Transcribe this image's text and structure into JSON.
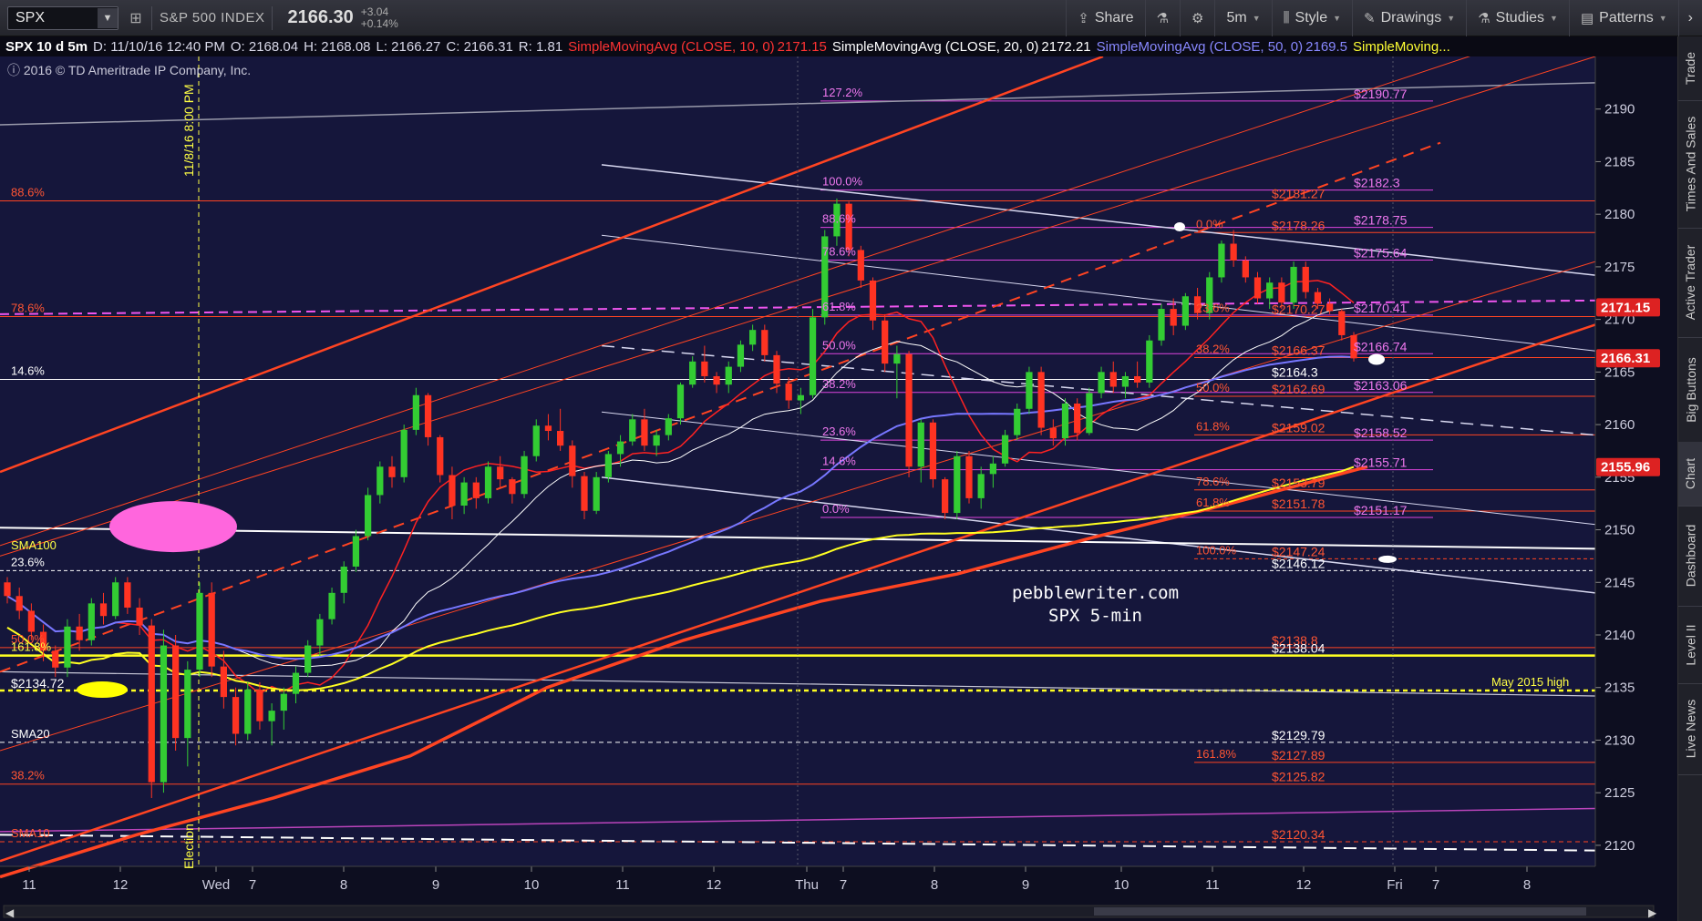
{
  "toolbar": {
    "symbol": "SPX",
    "name": "S&P 500 INDEX",
    "price": "2166.30",
    "change": "+3.04",
    "change_pct": "+0.14%",
    "buttons": [
      {
        "label": "Share",
        "icon": "share-icon"
      },
      {
        "label": "",
        "icon": "flask-icon"
      },
      {
        "label": "",
        "icon": "gear-icon"
      },
      {
        "label": "5m",
        "icon": ""
      },
      {
        "label": "Style",
        "icon": "style-icon"
      },
      {
        "label": "Drawings",
        "icon": "pencil-icon"
      },
      {
        "label": "Studies",
        "icon": "flask-icon"
      },
      {
        "label": "Patterns",
        "icon": "patterns-icon"
      }
    ]
  },
  "infobar": {
    "aggregation": "SPX 10 d 5m",
    "date": "D: 11/10/16 12:40 PM",
    "open": "O: 2168.04",
    "high": "H: 2168.08",
    "low": "L: 2166.27",
    "close": "C: 2166.31",
    "range": "R: 1.81",
    "studies": [
      {
        "label": "SimpleMovingAvg (CLOSE, 10, 0)",
        "value": "2171.15",
        "color": "#ff3333"
      },
      {
        "label": "SimpleMovingAvg (CLOSE, 20, 0)",
        "value": "2172.21",
        "color": "#ffffff"
      },
      {
        "label": "SimpleMovingAvg (CLOSE, 50, 0)",
        "value": "2169.5",
        "color": "#8888ff"
      },
      {
        "label": "SimpleMoving...",
        "value": "",
        "color": "#ffff33"
      }
    ]
  },
  "copyright": "2016 © TD Ameritrade IP Company, Inc.",
  "right_tabs": [
    "Trade",
    "Times And Sales",
    "Active Trader",
    "Big Buttons",
    "Chart",
    "Dashboard",
    "Level II",
    "Live News"
  ],
  "colors": {
    "background": "#15163b",
    "up_candle": "#33cc33",
    "down_candle": "#ff3322",
    "sma10": "#ff2222",
    "sma20": "#ffffff",
    "sma50": "#7777ff",
    "sma100": "#ffff22",
    "fib_pink": "#ee55ee",
    "fib_orange": "#ff4422",
    "channel_white": "#d8d8f0"
  },
  "chart_data": {
    "type": "candlestick",
    "symbol": "SPX",
    "interval": "5m",
    "ylim": [
      2118,
      2195
    ],
    "y_ticks": [
      2120,
      2125,
      2130,
      2135,
      2140,
      2145,
      2150,
      2155,
      2160,
      2165,
      2170,
      2175,
      2180,
      2185,
      2190
    ],
    "x_ticks": [
      "11",
      "12",
      "Wed",
      "7",
      "8",
      "9",
      "10",
      "11",
      "12",
      "Thu",
      "7",
      "8",
      "9",
      "10",
      "11",
      "12",
      "Fri",
      "7",
      "8"
    ],
    "price_badges": [
      {
        "value": "2171.15",
        "color": "#dd2222"
      },
      {
        "value": "2166.31",
        "color": "#dd2222"
      },
      {
        "value": "2155.96",
        "color": "#dd2222"
      }
    ],
    "candles": [
      [
        2145.0,
        2145.5,
        2143.0,
        2143.7
      ],
      [
        2143.7,
        2144.5,
        2141.5,
        2142.3
      ],
      [
        2142.3,
        2143.0,
        2139.5,
        2140.3
      ],
      [
        2140.3,
        2141.0,
        2137.5,
        2138.5
      ],
      [
        2138.5,
        2139.0,
        2136.0,
        2136.9
      ],
      [
        2136.9,
        2141.5,
        2136.0,
        2140.8
      ],
      [
        2140.8,
        2142.0,
        2138.5,
        2139.5
      ],
      [
        2139.5,
        2143.5,
        2139.0,
        2143.0
      ],
      [
        2143.0,
        2144.0,
        2141.0,
        2141.8
      ],
      [
        2141.8,
        2145.5,
        2141.5,
        2145.0
      ],
      [
        2145.0,
        2145.5,
        2142.0,
        2142.6
      ],
      [
        2142.6,
        2143.5,
        2140.0,
        2140.9
      ],
      [
        2140.9,
        2141.5,
        2124.5,
        2126.0
      ],
      [
        2126.0,
        2140.5,
        2125.0,
        2139.0
      ],
      [
        2139.0,
        2140.0,
        2129.0,
        2130.2
      ],
      [
        2130.2,
        2137.5,
        2127.5,
        2136.7
      ],
      [
        2136.7,
        2145.0,
        2136.0,
        2144.0
      ],
      [
        2144.0,
        2145.0,
        2136.0,
        2137.0
      ],
      [
        2137.0,
        2138.5,
        2133.0,
        2134.1
      ],
      [
        2134.1,
        2135.0,
        2129.5,
        2130.6
      ],
      [
        2130.6,
        2135.5,
        2130.0,
        2134.8
      ],
      [
        2134.8,
        2135.5,
        2131.0,
        2131.8
      ],
      [
        2131.8,
        2133.5,
        2129.5,
        2132.8
      ],
      [
        2132.8,
        2135.0,
        2131.0,
        2134.4
      ],
      [
        2134.4,
        2137.0,
        2133.5,
        2136.4
      ],
      [
        2136.4,
        2139.5,
        2136.0,
        2139.0
      ],
      [
        2139.0,
        2142.0,
        2138.0,
        2141.5
      ],
      [
        2141.5,
        2144.5,
        2141.0,
        2144.0
      ],
      [
        2144.0,
        2147.0,
        2143.0,
        2146.5
      ],
      [
        2146.5,
        2150.0,
        2146.0,
        2149.4
      ],
      [
        2149.4,
        2154.0,
        2149.0,
        2153.3
      ],
      [
        2153.3,
        2156.5,
        2152.5,
        2156.0
      ],
      [
        2156.0,
        2157.0,
        2154.0,
        2155.0
      ],
      [
        2155.0,
        2160.0,
        2154.5,
        2159.5
      ],
      [
        2159.5,
        2163.5,
        2159.0,
        2162.8
      ],
      [
        2162.8,
        2163.0,
        2158.0,
        2158.8
      ],
      [
        2158.8,
        2159.0,
        2154.5,
        2155.2
      ],
      [
        2155.2,
        2156.0,
        2151.0,
        2152.3
      ],
      [
        2152.3,
        2155.0,
        2151.5,
        2154.5
      ],
      [
        2154.5,
        2155.0,
        2152.0,
        2153.0
      ],
      [
        2153.0,
        2156.5,
        2152.5,
        2156.0
      ],
      [
        2156.0,
        2157.0,
        2154.0,
        2154.8
      ],
      [
        2154.8,
        2155.0,
        2152.5,
        2153.4
      ],
      [
        2153.4,
        2157.5,
        2153.0,
        2157.0
      ],
      [
        2157.0,
        2160.5,
        2156.5,
        2159.9
      ],
      [
        2159.9,
        2161.0,
        2158.5,
        2159.4
      ],
      [
        2159.4,
        2161.5,
        2157.5,
        2158.0
      ],
      [
        2158.0,
        2158.5,
        2154.0,
        2155.1
      ],
      [
        2155.1,
        2155.5,
        2151.0,
        2151.8
      ],
      [
        2151.8,
        2155.5,
        2151.5,
        2155.0
      ],
      [
        2155.0,
        2157.5,
        2154.5,
        2157.2
      ],
      [
        2157.2,
        2159.0,
        2156.0,
        2158.4
      ],
      [
        2158.4,
        2161.0,
        2158.0,
        2160.5
      ],
      [
        2160.5,
        2161.5,
        2157.5,
        2158.0
      ],
      [
        2158.0,
        2159.5,
        2157.0,
        2159.0
      ],
      [
        2159.0,
        2161.0,
        2158.5,
        2160.6
      ],
      [
        2160.6,
        2164.0,
        2160.0,
        2163.8
      ],
      [
        2163.8,
        2166.5,
        2163.5,
        2166.0
      ],
      [
        2166.0,
        2167.5,
        2164.0,
        2164.6
      ],
      [
        2164.6,
        2165.0,
        2163.0,
        2163.8
      ],
      [
        2163.8,
        2166.0,
        2163.0,
        2165.5
      ],
      [
        2165.5,
        2168.0,
        2165.0,
        2167.6
      ],
      [
        2167.6,
        2169.5,
        2167.0,
        2169.0
      ],
      [
        2169.0,
        2169.5,
        2166.0,
        2166.6
      ],
      [
        2166.6,
        2167.0,
        2163.0,
        2163.9
      ],
      [
        2163.9,
        2164.5,
        2161.5,
        2162.3
      ],
      [
        2162.3,
        2163.5,
        2161.0,
        2162.8
      ],
      [
        2162.8,
        2171.0,
        2162.5,
        2170.2
      ],
      [
        2170.2,
        2178.5,
        2169.5,
        2177.9
      ],
      [
        2177.9,
        2181.5,
        2177.0,
        2181.0
      ],
      [
        2181.0,
        2181.2,
        2176.0,
        2176.6
      ],
      [
        2176.6,
        2177.0,
        2173.0,
        2173.7
      ],
      [
        2173.7,
        2174.0,
        2169.0,
        2169.9
      ],
      [
        2169.9,
        2170.5,
        2165.0,
        2165.8
      ],
      [
        2165.8,
        2167.5,
        2162.5,
        2166.7
      ],
      [
        2166.7,
        2167.0,
        2155.0,
        2156.0
      ],
      [
        2156.0,
        2160.5,
        2154.5,
        2160.2
      ],
      [
        2160.2,
        2160.5,
        2154.0,
        2154.8
      ],
      [
        2154.8,
        2155.0,
        2151.0,
        2151.6
      ],
      [
        2151.6,
        2157.5,
        2151.0,
        2157.0
      ],
      [
        2157.0,
        2157.5,
        2152.5,
        2153.0
      ],
      [
        2153.0,
        2156.0,
        2152.0,
        2155.3
      ],
      [
        2155.3,
        2157.0,
        2154.0,
        2156.3
      ],
      [
        2156.3,
        2159.5,
        2156.0,
        2159.0
      ],
      [
        2159.0,
        2162.0,
        2158.5,
        2161.5
      ],
      [
        2161.5,
        2165.5,
        2161.0,
        2165.0
      ],
      [
        2165.0,
        2165.5,
        2159.0,
        2159.7
      ],
      [
        2159.7,
        2160.5,
        2158.0,
        2158.7
      ],
      [
        2158.7,
        2162.5,
        2158.0,
        2162.0
      ],
      [
        2162.0,
        2162.5,
        2158.5,
        2159.2
      ],
      [
        2159.2,
        2163.5,
        2159.0,
        2163.0
      ],
      [
        2163.0,
        2165.5,
        2162.5,
        2165.0
      ],
      [
        2165.0,
        2166.0,
        2163.0,
        2163.6
      ],
      [
        2163.6,
        2165.0,
        2162.5,
        2164.6
      ],
      [
        2164.6,
        2166.0,
        2163.5,
        2164.0
      ],
      [
        2164.0,
        2168.5,
        2163.5,
        2168.0
      ],
      [
        2168.0,
        2171.5,
        2167.5,
        2171.0
      ],
      [
        2171.0,
        2172.0,
        2168.5,
        2169.4
      ],
      [
        2169.4,
        2172.5,
        2169.0,
        2172.2
      ],
      [
        2172.2,
        2173.0,
        2170.0,
        2170.6
      ],
      [
        2170.6,
        2174.5,
        2170.0,
        2174.0
      ],
      [
        2174.0,
        2177.5,
        2173.5,
        2177.2
      ],
      [
        2177.2,
        2178.5,
        2175.0,
        2175.6
      ],
      [
        2175.6,
        2176.0,
        2173.5,
        2174.0
      ],
      [
        2174.0,
        2174.5,
        2171.5,
        2172.0
      ],
      [
        2172.0,
        2174.0,
        2171.0,
        2173.5
      ],
      [
        2173.5,
        2174.0,
        2171.0,
        2171.6
      ],
      [
        2171.6,
        2175.5,
        2171.0,
        2175.0
      ],
      [
        2175.0,
        2175.5,
        2172.0,
        2172.6
      ],
      [
        2172.6,
        2173.0,
        2171.0,
        2171.5
      ],
      [
        2171.5,
        2172.0,
        2170.5,
        2170.8
      ],
      [
        2170.8,
        2171.0,
        2168.0,
        2168.5
      ],
      [
        2168.5,
        2168.8,
        2166.0,
        2166.3
      ]
    ],
    "horizontal_levels": [
      {
        "price": 2190.77,
        "label": "$2190.77",
        "pct": "127.2%",
        "color": "#dd44dd"
      },
      {
        "price": 2182.3,
        "label": "$2182.3",
        "pct": "100.0%",
        "color": "#dd44dd"
      },
      {
        "price": 2181.27,
        "label": "$2181.27",
        "pct": "88.6%",
        "color": "#ff4422"
      },
      {
        "price": 2178.75,
        "label": "$2178.75",
        "pct": "88.6%",
        "color": "#dd44dd"
      },
      {
        "price": 2178.26,
        "label": "$2178.26",
        "pct": "0.0%",
        "color": "#ff4422"
      },
      {
        "price": 2175.64,
        "label": "$2175.64",
        "pct": "78.6%",
        "color": "#dd44dd"
      },
      {
        "price": 2170.41,
        "label": "$2170.41",
        "pct": "61.8%",
        "color": "#dd44dd"
      },
      {
        "price": 2170.27,
        "label": "$2170.27",
        "pct": "23.6%",
        "color": "#ff4422"
      },
      {
        "price": 2170.27,
        "label": "",
        "pct": "78.6%",
        "color": "#ff4422"
      },
      {
        "price": 2166.74,
        "label": "$2166.74",
        "pct": "50.0%",
        "color": "#dd44dd"
      },
      {
        "price": 2166.37,
        "label": "$2166.37",
        "pct": "38.2%",
        "color": "#ff4422"
      },
      {
        "price": 2164.3,
        "label": "$2164.3",
        "pct": "14.6%",
        "color": "#ffffff"
      },
      {
        "price": 2163.06,
        "label": "$2163.06",
        "pct": "38.2%",
        "color": "#dd44dd"
      },
      {
        "price": 2162.69,
        "label": "$2162.69",
        "pct": "50.0%",
        "color": "#ff4422"
      },
      {
        "price": 2159.02,
        "label": "$2159.02",
        "pct": "61.8%",
        "color": "#ff4422"
      },
      {
        "price": 2158.52,
        "label": "$2158.52",
        "pct": "23.6%",
        "color": "#dd44dd"
      },
      {
        "price": 2155.71,
        "label": "$2155.71",
        "pct": "14.6%",
        "color": "#dd44dd"
      },
      {
        "price": 2153.79,
        "label": "$2153.79",
        "pct": "78.6%",
        "color": "#ff4422"
      },
      {
        "price": 2151.78,
        "label": "$2151.78",
        "pct": "61.8%",
        "color": "#ff4422"
      },
      {
        "price": 2151.17,
        "label": "$2151.17",
        "pct": "0.0%",
        "color": "#dd44dd"
      },
      {
        "price": 2147.24,
        "label": "$2147.24",
        "pct": "100.0%",
        "color": "#ff4422"
      },
      {
        "price": 2146.12,
        "label": "$2146.12",
        "pct": "23.6%",
        "color": "#ffffff"
      },
      {
        "price": 2138.8,
        "label": "$2138.8",
        "pct": "50.0%",
        "color": "#ff4422"
      },
      {
        "price": 2138.04,
        "label": "$2138.04",
        "pct": "161.8%",
        "color": "#ffff22"
      },
      {
        "price": 2134.72,
        "label": "$2134.72",
        "pct": "May 2015 high",
        "color": "#ffff22"
      },
      {
        "price": 2129.79,
        "label": "$2129.79",
        "pct": "SMA20",
        "color": "#ffffff"
      },
      {
        "price": 2127.89,
        "label": "$2127.89",
        "pct": "161.8%",
        "color": "#ff4422"
      },
      {
        "price": 2125.82,
        "label": "$2125.82",
        "pct": "38.2%",
        "color": "#ff4422"
      },
      {
        "price": 2120.34,
        "label": "$2120.34",
        "pct": "SMA10",
        "color": "#ff4422"
      }
    ],
    "annotations": [
      {
        "text": "pebblewriter.com"
      },
      {
        "text": "SPX 5-min"
      },
      {
        "text": "11/8/16 8:00 PM"
      },
      {
        "text": "Election"
      },
      {
        "text": "SMA100"
      }
    ]
  }
}
